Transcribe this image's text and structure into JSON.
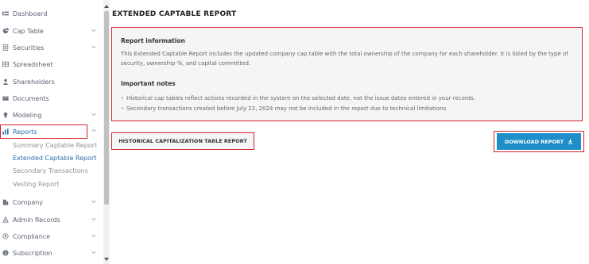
{
  "sidebar": {
    "items": [
      {
        "label": "Dashboard",
        "icon": "dashboard-icon"
      },
      {
        "label": "Cap Table",
        "icon": "pie-chart-icon"
      },
      {
        "label": "Securities",
        "icon": "document-icon"
      },
      {
        "label": "Spreadsheet",
        "icon": "spreadsheet-icon"
      },
      {
        "label": "Shareholders",
        "icon": "user-icon"
      },
      {
        "label": "Documents",
        "icon": "folder-icon"
      },
      {
        "label": "Modeling",
        "icon": "lightbulb-icon"
      },
      {
        "label": "Reports",
        "icon": "bar-chart-icon"
      },
      {
        "label": "Company",
        "icon": "building-icon"
      },
      {
        "label": "Admin Records",
        "icon": "records-icon"
      },
      {
        "label": "Compliance",
        "icon": "shield-icon"
      },
      {
        "label": "Subscription",
        "icon": "info-icon"
      }
    ],
    "report_subitems": [
      {
        "label": "Summary Captable Report"
      },
      {
        "label": "Extended Captable Report"
      },
      {
        "label": "Secondary Transactions"
      },
      {
        "label": "Vesting Report"
      }
    ]
  },
  "main": {
    "title": "EXTENDED CAPTABLE REPORT",
    "info_heading": "Report information",
    "info_text": "This Extended Captable Report includes the updated company cap table with the total ownership of the company for each shareholder. It is listed by the type of security, ownership %, and capital committed.",
    "notes_heading": "Important notes",
    "notes": [
      "Historical cap tables reflect actions recorded in the system on the selected date, not the issue dates entered in your records.",
      "Secondary transactions created before July 22, 2024 may not be included in the report due to technical limitations"
    ],
    "historical_button": "HISTORICAL CAPITALIZATION TABLE REPORT",
    "download_button": "DOWNLOAD REPORT"
  },
  "colors": {
    "accent": "#1f8fc9",
    "highlight_border": "#d3232b",
    "active_link": "#2f6fae",
    "bullet": "#e8842f"
  }
}
